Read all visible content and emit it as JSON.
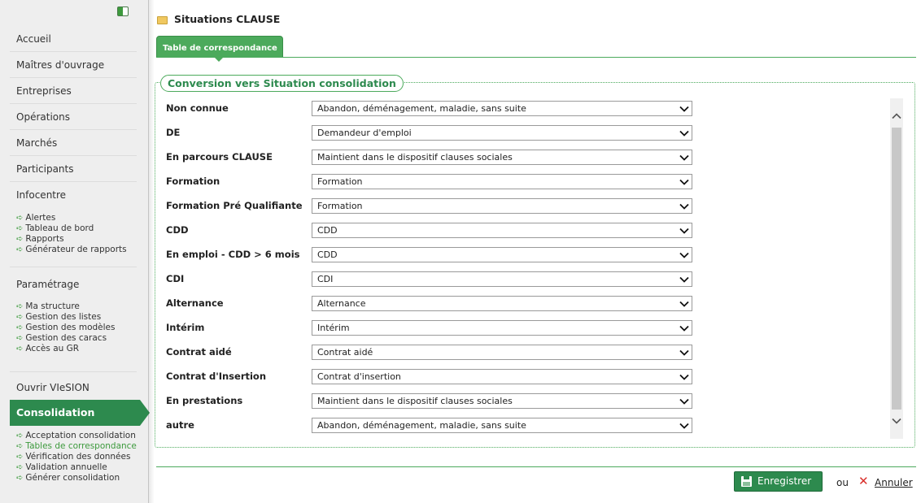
{
  "sidebar": {
    "nav": [
      "Accueil",
      "Maîtres d'ouvrage",
      "Entreprises",
      "Opérations",
      "Marchés",
      "Participants",
      "Infocentre"
    ],
    "infocentre_sub": [
      "Alertes",
      "Tableau de bord",
      "Rapports",
      "Générateur de rapports"
    ],
    "parametrage": "Paramétrage",
    "parametrage_sub": [
      "Ma structure",
      "Gestion des listes",
      "Gestion des modèles",
      "Gestion des caracs",
      "Accès au GR"
    ],
    "ouvrir": "Ouvrir VIeSION",
    "consolidation": "Consolidation",
    "consolidation_sub": [
      "Acceptation consolidation",
      "Tables de correspondance",
      "Vérification des données",
      "Validation annuelle",
      "Générer consolidation"
    ]
  },
  "header": {
    "title": "Situations CLAUSE"
  },
  "tab": {
    "label": "Table de correspondance"
  },
  "section": {
    "legend": "Conversion vers Situation consolidation"
  },
  "rows": [
    {
      "label": "Non connue",
      "value": "Abandon, déménagement, maladie, sans suite"
    },
    {
      "label": "DE",
      "value": "Demandeur d'emploi"
    },
    {
      "label": "En parcours CLAUSE",
      "value": "Maintient dans le dispositif clauses sociales"
    },
    {
      "label": "Formation",
      "value": "Formation"
    },
    {
      "label": "Formation Pré Qualifiante",
      "value": "Formation"
    },
    {
      "label": "CDD",
      "value": "CDD"
    },
    {
      "label": "En emploi - CDD > 6 mois",
      "value": "CDD"
    },
    {
      "label": "CDI",
      "value": "CDI"
    },
    {
      "label": "Alternance",
      "value": "Alternance"
    },
    {
      "label": "Intérim",
      "value": "Intérim"
    },
    {
      "label": "Contrat aidé",
      "value": "Contrat aidé"
    },
    {
      "label": "Contrat d'Insertion",
      "value": "Contrat d'insertion"
    },
    {
      "label": "En prestations",
      "value": "Maintient dans le dispositif clauses sociales"
    },
    {
      "label": "autre",
      "value": "Abandon, déménagement, maladie, sans suite"
    }
  ],
  "footer": {
    "save": "Enregistrer",
    "or": "ou",
    "cancel": "Annuler"
  },
  "colors": {
    "accent": "#2d8a4e",
    "tab": "#4caa5c",
    "cancel": "#d9302c"
  }
}
